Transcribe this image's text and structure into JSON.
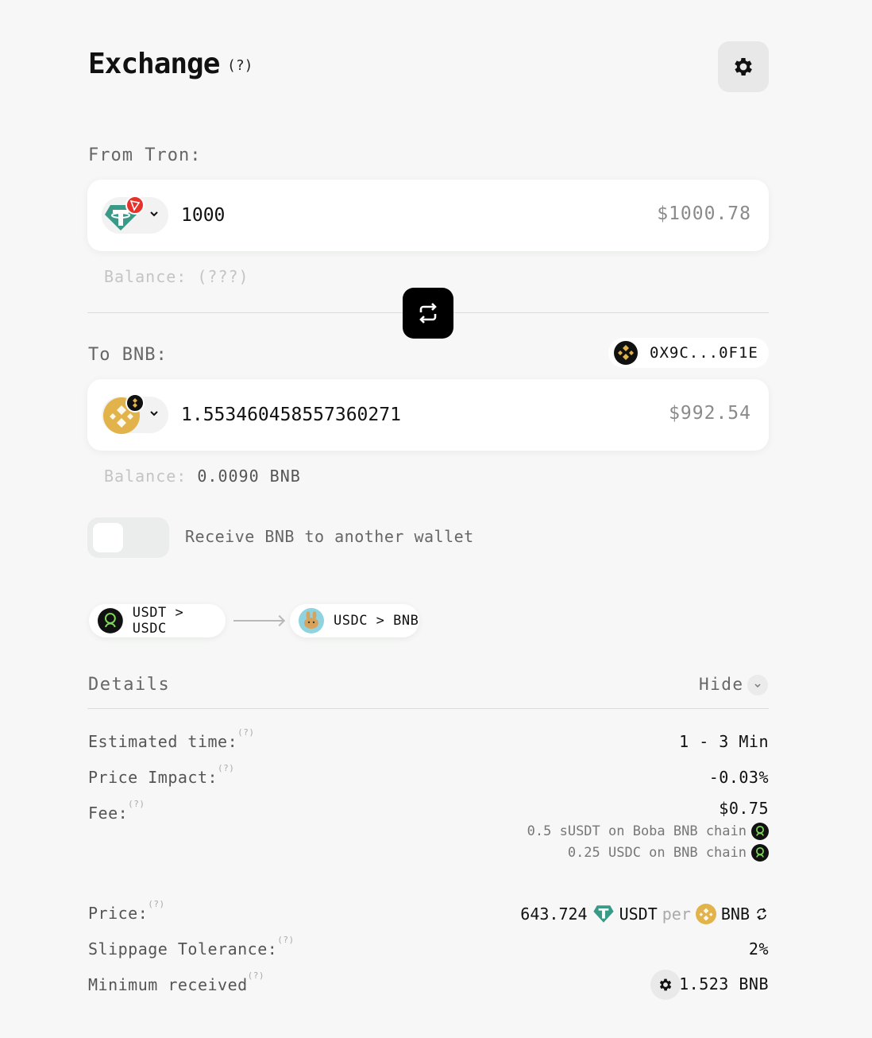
{
  "header": {
    "title": "Exchange",
    "help_marker": "(?)"
  },
  "from": {
    "label": "From Tron:",
    "token_icon": "usdt-tron-icon",
    "amount": "1000",
    "usd_value": "$1000.78",
    "balance_label": "Balance:",
    "balance_value": "(???)"
  },
  "to": {
    "label": "To BNB:",
    "wallet_address": "0X9C...0F1E",
    "token_icon": "bnb-icon",
    "amount": "1.553460458557360271",
    "usd_value": "$992.54",
    "balance_label": "Balance:",
    "balance_value": "0.0090 BNB"
  },
  "toggle": {
    "label": "Receive BNB to another wallet",
    "enabled": false
  },
  "route": [
    {
      "label": "USDT > USDC",
      "icon": "boba-icon"
    },
    {
      "label": "USDC > BNB",
      "icon": "pancakeswap-icon"
    }
  ],
  "details": {
    "title": "Details",
    "hide_label": "Hide",
    "estimated_time": {
      "label": "Estimated time:",
      "value": "1 - 3 Min"
    },
    "price_impact": {
      "label": "Price Impact:",
      "value": "-0.03%"
    },
    "fee": {
      "label": "Fee:",
      "value": "$0.75",
      "breakdown": [
        "0.5 sUSDT on Boba BNB chain",
        "0.25 USDC on BNB chain"
      ]
    },
    "price": {
      "label": "Price:",
      "amount": "643.724",
      "base": "USDT",
      "per": "per",
      "quote": "BNB"
    },
    "slippage": {
      "label": "Slippage Tolerance:",
      "value": "2%"
    },
    "minimum_received": {
      "label": "Minimum received",
      "value": "1.523 BNB"
    },
    "help_marker": "(?)"
  },
  "colors": {
    "background": "#f6f7f6",
    "tether": "#26a17b",
    "tron": "#e8312b",
    "bnb": "#e2b34a",
    "accent_black": "#000000"
  }
}
